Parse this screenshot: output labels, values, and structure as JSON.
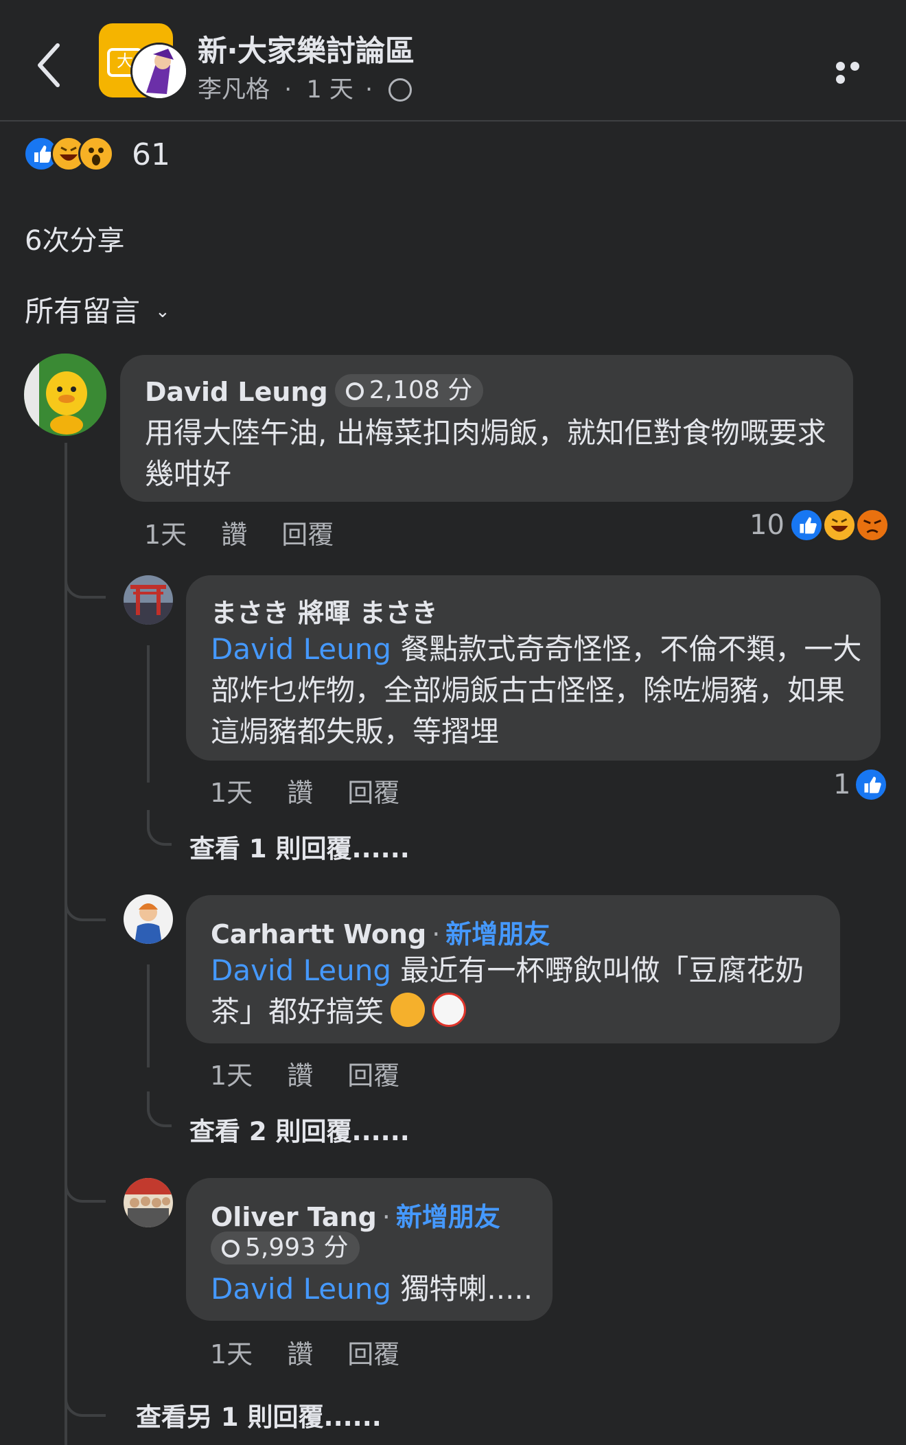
{
  "header": {
    "group_name": "新‧大家樂討論區",
    "poster": "李凡格",
    "time": "1 天",
    "sep": "·"
  },
  "post": {
    "reaction_count": "61",
    "shares": "6次分享",
    "filter_label": "所有留言"
  },
  "comments": [
    {
      "author": "David Leung",
      "badge": "2,108 分",
      "text": "用得大陸午油, 出梅菜扣肉焗飯，就知佢對食物嘅要求幾咁好",
      "time": "1天",
      "like": "讚",
      "reply": "回覆",
      "reaction_count": "10"
    }
  ],
  "replies": [
    {
      "author": "まさき 將暉 まさき",
      "mention": "David Leung",
      "text": " 餐點款式奇奇怪怪，不倫不類，一大部炸乜炸物，全部焗飯古古怪怪，除咗焗豬，如果這焗豬都失販，等摺埋",
      "time": "1天",
      "like": "讚",
      "reply": "回覆",
      "reaction_count": "1",
      "view_more": "查看 1 則回覆......"
    },
    {
      "author": "Carhartt Wong",
      "add_friend": "新增朋友",
      "mention": "David Leung",
      "text": " 最近有一杯嘢飲叫做「豆腐花奶茶」都好搞笑",
      "time": "1天",
      "like": "讚",
      "reply": "回覆",
      "view_more": "查看 2 則回覆......"
    },
    {
      "author": "Oliver  Tang",
      "add_friend": "新增朋友",
      "badge": "5,993 分",
      "mention": "David Leung",
      "text": " 獨特喇.....",
      "time": "1天",
      "like": "讚",
      "reply": "回覆"
    }
  ],
  "thread_more": "查看另 1 則回覆......",
  "colors": {
    "background": "#242526",
    "bubble": "#3a3b3c",
    "mention": "#4599ff",
    "like": "#1877f2",
    "haha": "#f7b125",
    "angry": "#e9710f"
  },
  "icons": [
    "back-icon",
    "globe-icon",
    "more-icon",
    "like-icon",
    "haha-icon",
    "wow-icon",
    "angry-icon",
    "chevron-down-icon",
    "trophy-icon",
    "laughing-cat-emoji",
    "clown-emoji"
  ]
}
